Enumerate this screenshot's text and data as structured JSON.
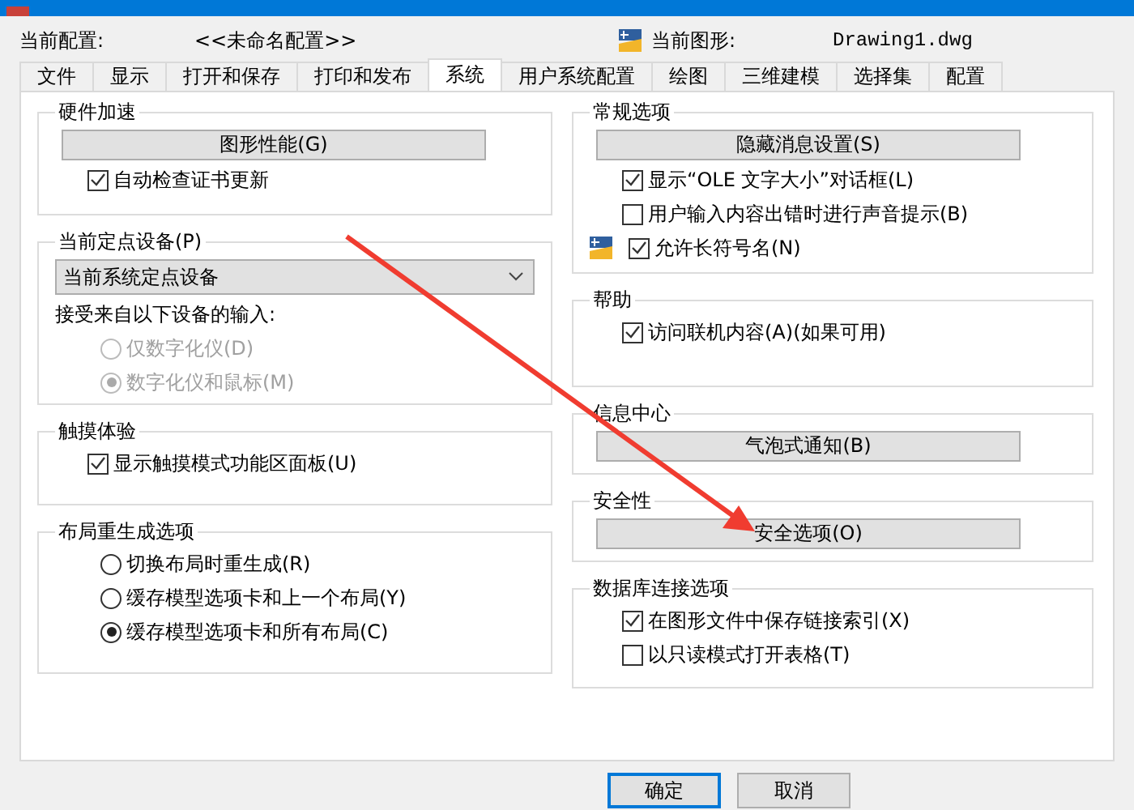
{
  "header": {
    "profile_label": "当前配置:",
    "profile_value": "<<未命名配置>>",
    "drawing_label": "当前图形:",
    "drawing_value": "Drawing1.dwg"
  },
  "tabs": [
    {
      "label": "文件",
      "selected": false
    },
    {
      "label": "显示",
      "selected": false
    },
    {
      "label": "打开和保存",
      "selected": false
    },
    {
      "label": "打印和发布",
      "selected": false
    },
    {
      "label": "系统",
      "selected": true
    },
    {
      "label": "用户系统配置",
      "selected": false
    },
    {
      "label": "绘图",
      "selected": false
    },
    {
      "label": "三维建模",
      "selected": false
    },
    {
      "label": "选择集",
      "selected": false
    },
    {
      "label": "配置",
      "selected": false
    }
  ],
  "left_groups": [
    {
      "title": "硬件加速",
      "items": [
        {
          "kind": "button",
          "label": "图形性能(G)"
        },
        {
          "kind": "checkbox",
          "label": "自动检查证书更新",
          "checked": true
        }
      ]
    },
    {
      "title": "当前定点设备(P)",
      "items": [
        {
          "kind": "combo",
          "value": "当前系统定点设备"
        },
        {
          "kind": "label",
          "label": "接受来自以下设备的输入:"
        },
        {
          "kind": "radio",
          "label": "仅数字化仪(D)",
          "selected": false,
          "disabled": true
        },
        {
          "kind": "radio",
          "label": "数字化仪和鼠标(M)",
          "selected": true,
          "disabled": true
        }
      ]
    },
    {
      "title": "触摸体验",
      "items": [
        {
          "kind": "checkbox",
          "label": "显示触摸模式功能区面板(U)",
          "checked": true
        }
      ]
    },
    {
      "title": "布局重生成选项",
      "items": [
        {
          "kind": "radio",
          "label": "切换布局时重生成(R)",
          "selected": false,
          "disabled": false
        },
        {
          "kind": "radio",
          "label": "缓存模型选项卡和上一个布局(Y)",
          "selected": false,
          "disabled": false
        },
        {
          "kind": "radio",
          "label": "缓存模型选项卡和所有布局(C)",
          "selected": true,
          "disabled": false
        }
      ]
    }
  ],
  "right_groups": [
    {
      "title": "常规选项",
      "items": [
        {
          "kind": "button",
          "label": "隐藏消息设置(S)"
        },
        {
          "kind": "checkbox",
          "label": "显示“OLE 文字大小”对话框(L)",
          "checked": true
        },
        {
          "kind": "checkbox",
          "label": "用户输入内容出错时进行声音提示(B)",
          "checked": false
        },
        {
          "kind": "checkbox",
          "label": "允许长符号名(N)",
          "checked": true,
          "badge": true
        }
      ]
    },
    {
      "title": "帮助",
      "items": [
        {
          "kind": "checkbox",
          "label": "访问联机内容(A)(如果可用)",
          "checked": true
        }
      ]
    },
    {
      "title": "信息中心",
      "items": [
        {
          "kind": "button",
          "label": "气泡式通知(B)"
        }
      ]
    },
    {
      "title": "安全性",
      "items": [
        {
          "kind": "button",
          "label": "安全选项(O)"
        }
      ]
    },
    {
      "title": "数据库连接选项",
      "items": [
        {
          "kind": "checkbox",
          "label": "在图形文件中保存链接索引(X)",
          "checked": true
        },
        {
          "kind": "checkbox",
          "label": "以只读模式打开表格(T)",
          "checked": false
        }
      ]
    }
  ],
  "footer_buttons": [
    {
      "label": "确定",
      "selected": true
    },
    {
      "label": "取消",
      "selected": false
    }
  ]
}
